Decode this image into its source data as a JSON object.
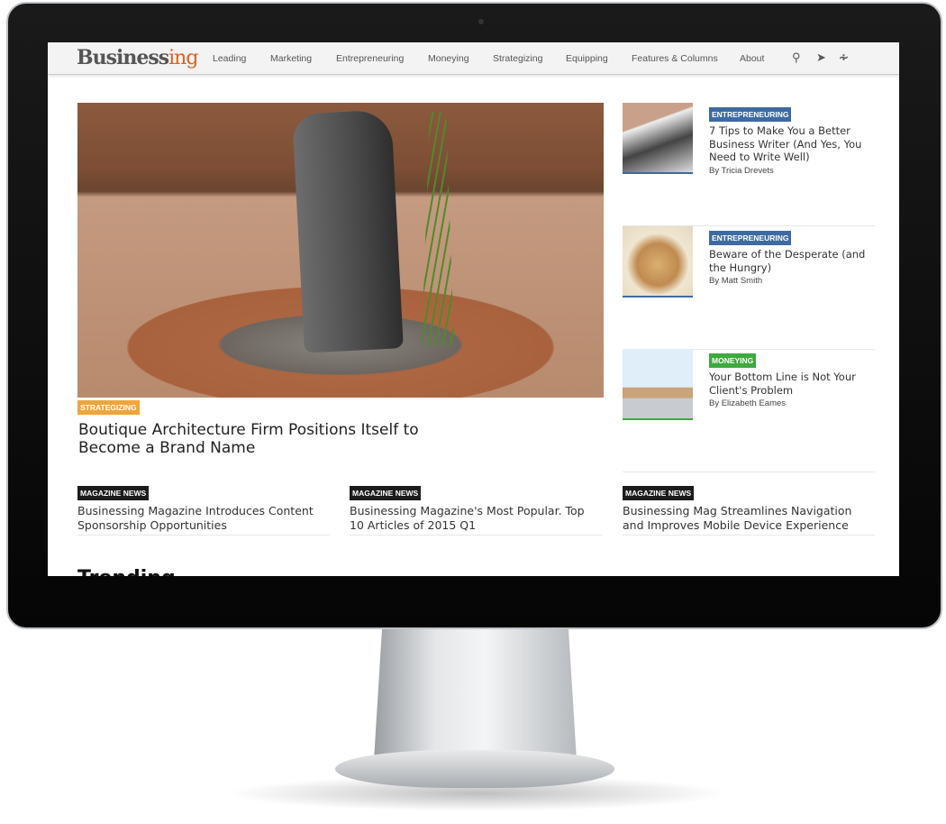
{
  "site": {
    "logo_main": "Business",
    "logo_accent": "ing"
  },
  "nav": {
    "items": [
      "Leading",
      "Marketing",
      "Entrepreneuring",
      "Moneying",
      "Strategizing",
      "Equipping",
      "Features & Columns",
      "About"
    ],
    "icons": [
      "search-icon",
      "send-icon",
      "rss-icon"
    ]
  },
  "hero": {
    "category": "STRATEGIZING",
    "category_color": "#f0a53a",
    "title": "Boutique Architecture Firm Positions Itself to Become a Brand Name"
  },
  "sidebar": [
    {
      "category": "ENTREPRENEURING",
      "color": "#3e6aa3",
      "title": "7 Tips to Make You a Better Business Writer (And Yes, You Need to Write Well)",
      "author": "By Tricia Drevets"
    },
    {
      "category": "ENTREPRENEURING",
      "color": "#3e6aa3",
      "title": "Beware of the Desperate (and the Hungry)",
      "author": "By Matt Smith"
    },
    {
      "category": "MONEYING",
      "color": "#3daa3d",
      "title": "Your Bottom Line is Not Your Client's Problem",
      "author": "By Elizabeth Eames"
    }
  ],
  "news": [
    {
      "category": "MAGAZINE NEWS",
      "title": "Businessing Magazine Introduces Content Sponsorship Opportunities"
    },
    {
      "category": "MAGAZINE NEWS",
      "title": "Businessing Magazine's Most Popular. Top 10 Articles of 2015 Q1"
    },
    {
      "category": "MAGAZINE NEWS",
      "title": "Businessing Mag Streamlines Navigation and Improves Mobile Device Experience"
    }
  ],
  "section_heading": "Trending"
}
